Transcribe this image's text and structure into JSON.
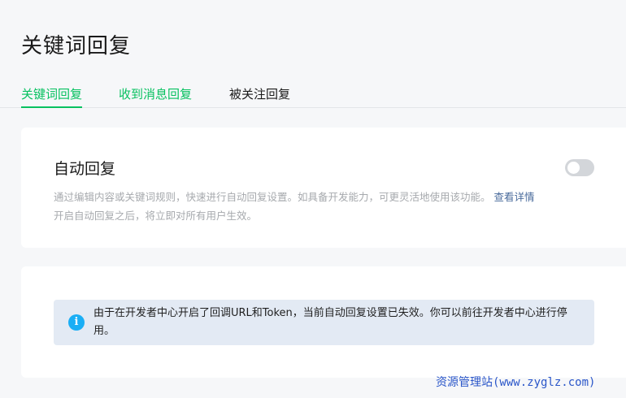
{
  "page": {
    "title": "关键词回复"
  },
  "tabs": [
    {
      "label": "关键词回复"
    },
    {
      "label": "收到消息回复"
    },
    {
      "label": "被关注回复"
    }
  ],
  "auto_reply": {
    "title": "自动回复",
    "toggle_on": false,
    "description_line1": "通过编辑内容或关键词规则，快速进行自动回复设置。如具备开发能力，可更灵活地使用该功能。",
    "details_link": "查看详情",
    "description_line2": "开启自动回复之后，将立即对所有用户生效。"
  },
  "notice": {
    "icon": "info-icon",
    "text": "由于在开发者中心开启了回调URL和Token，当前自动回复设置已失效。你可以前往开发者中心进行停用。"
  },
  "watermark": {
    "text": "资源管理站(www.zyglz.com)"
  },
  "colors": {
    "accent": "#07c160",
    "link": "#486a9b",
    "info": "#1aaef5",
    "notice_bg": "#e3eaf4"
  }
}
